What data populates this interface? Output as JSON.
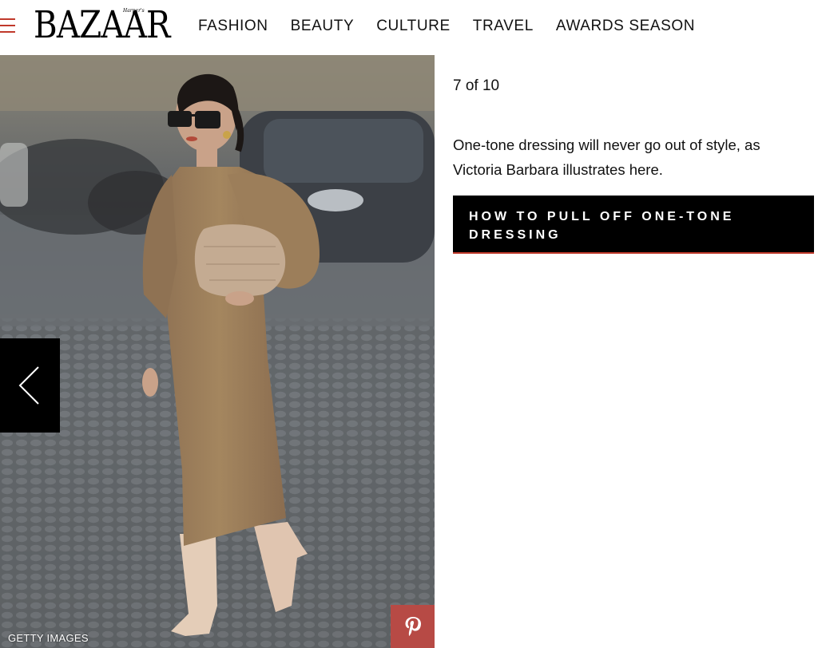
{
  "header": {
    "logo_text": "BAZAAR",
    "logo_small": "Harper's",
    "nav": [
      "FASHION",
      "BEAUTY",
      "CULTURE",
      "TRAVEL",
      "AWARDS SEASON"
    ]
  },
  "slideshow": {
    "counter": "7 of 10",
    "caption": "One-tone dressing will never go out of style, as Victoria Barbara illustrates here.",
    "cta_label": "HOW TO PULL OFF ONE-TONE DRESSING",
    "photo_credit": "GETTY IMAGES"
  },
  "icons": {
    "menu": "hamburger-menu-icon",
    "prev": "chevron-left-icon",
    "pinterest": "pinterest-icon"
  },
  "colors": {
    "accent_red": "#c0392b",
    "pinterest_bg": "#b74a45",
    "cta_bg": "#000000"
  }
}
